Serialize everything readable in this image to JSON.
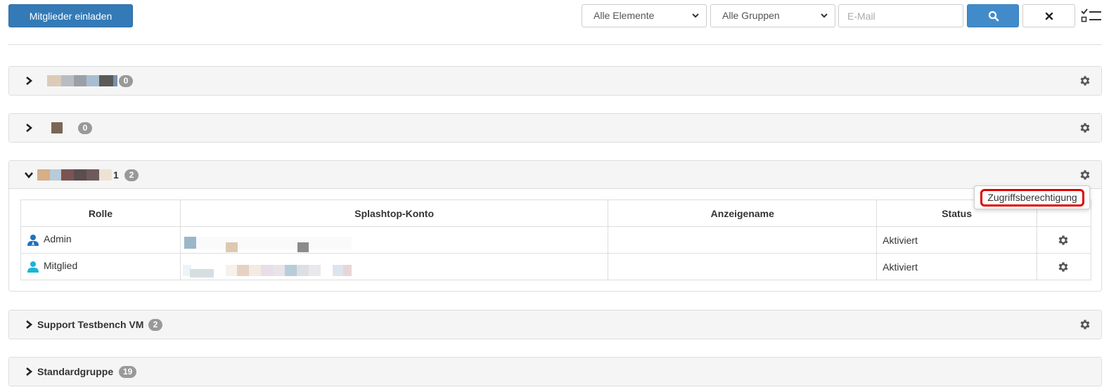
{
  "toolbar": {
    "invite_label": "Mitglieder einladen",
    "filter_elements": "Alle Elemente",
    "filter_groups": "Alle Gruppen",
    "email_placeholder": "E-Mail",
    "search_icon": "search-icon",
    "clear_icon": "close-icon",
    "list_icon": "checklist-icon"
  },
  "groups": [
    {
      "name": "",
      "count": "0",
      "expanded": false
    },
    {
      "name": "",
      "count": "0",
      "expanded": false
    },
    {
      "name": "1",
      "count": "2",
      "expanded": true
    },
    {
      "name": "Support Testbench VM",
      "count": "2",
      "expanded": false
    },
    {
      "name": "Standardgruppe",
      "count": "19",
      "expanded": false
    }
  ],
  "popover": {
    "item": "Zugriffsberechtigung"
  },
  "table": {
    "headers": [
      "Rolle",
      "Splashtop-Konto",
      "Anzeigename",
      "Status",
      ""
    ],
    "rows": [
      {
        "role": "Admin",
        "account": "",
        "display_name": "",
        "status": "Aktiviert"
      },
      {
        "role": "Mitglied",
        "account": "",
        "display_name": "",
        "status": "Aktiviert"
      }
    ]
  },
  "colors": {
    "primary": "#337ab7",
    "search": "#428bca",
    "highlight": "#e00000",
    "admin_icon": "#1e73be",
    "member_icon": "#1cb4d8"
  }
}
